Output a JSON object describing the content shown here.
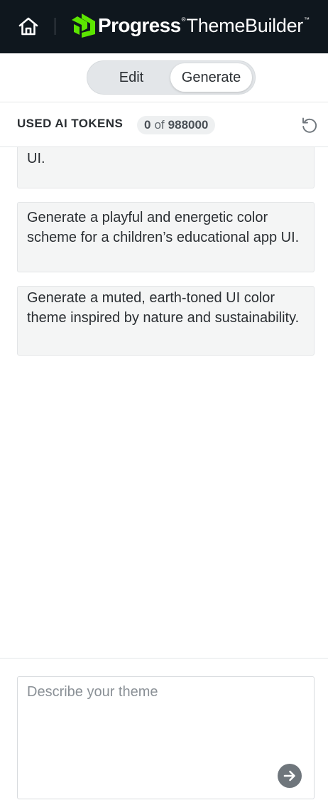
{
  "header": {
    "home_icon": "home-icon",
    "brand_name": "Progress",
    "brand_registered": "®",
    "product_name": "ThemeBuilder",
    "product_tm": "™",
    "logo_color": "#5ce500"
  },
  "mode_switch": {
    "edit_label": "Edit",
    "generate_label": "Generate",
    "selected": "Generate"
  },
  "tokens": {
    "label": "USED AI TOKENS",
    "used": "0",
    "of_label": "of",
    "total": "988000",
    "reset_icon": "undo-icon"
  },
  "suggestions": [
    {
      "text": "suitable for a wedding planning application UI."
    },
    {
      "text": "Generate a playful and energetic color scheme for a children’s educational app UI."
    },
    {
      "text": "Generate a muted, earth-toned UI color theme inspired by nature and sustainability."
    }
  ],
  "prompt": {
    "placeholder": "Describe your theme",
    "value": "",
    "send_icon": "arrow-right-icon"
  },
  "colors": {
    "header_bg": "#0f171e",
    "suggestion_bg": "#f4f5f5",
    "send_button": "#6f767c"
  }
}
